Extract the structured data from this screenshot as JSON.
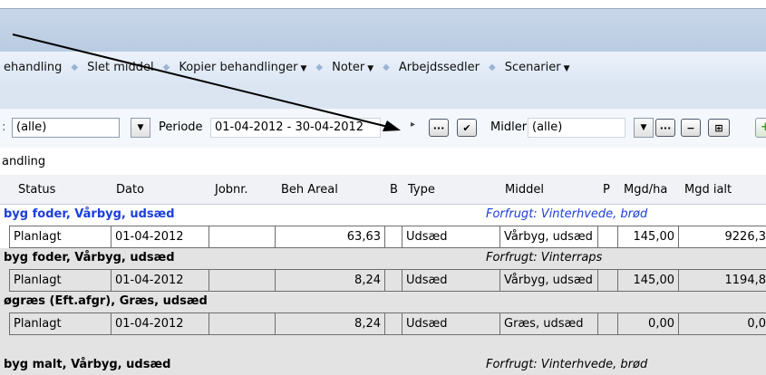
{
  "menu": {
    "items": [
      {
        "label": "ehandling",
        "dropdown": false
      },
      {
        "label": "Slet middel",
        "dropdown": false
      },
      {
        "label": "Kopier behandlinger",
        "dropdown": true
      },
      {
        "label": "Noter",
        "dropdown": true
      },
      {
        "label": "Arbejdssedler",
        "dropdown": false
      },
      {
        "label": "Scenarier",
        "dropdown": true
      }
    ],
    "separator_glyph": "◆",
    "caret_glyph": "▼"
  },
  "filters": {
    "status_prefix": ":",
    "status_value": "(alle)",
    "periode_label": "Periode",
    "periode_value": "01-04-2012 - 30-04-2012",
    "midler_label": "Midler",
    "midler_value": "(alle)",
    "ellipsis_label": "···",
    "check_label": "✔",
    "minus_label": "−",
    "addrow_label": "⊞",
    "next_glyph": "▸"
  },
  "section_title": "andling",
  "columns": [
    "Status",
    "Dato",
    "Jobnr.",
    "Beh Areal",
    "B",
    "Type",
    "Middel",
    "P",
    "Mgd/ha",
    "Mgd ialt"
  ],
  "groups": [
    {
      "title": "byg foder, Vårbyg, udsæd",
      "forfrugt": "Forfrugt: Vinterhvede, brød",
      "style": "blue",
      "row": {
        "status": "Planlagt",
        "dato": "01-04-2012",
        "jobnr": "",
        "areal": "63,63",
        "b": "",
        "type": "Udsæd",
        "middel": "Vårbyg, udsæd",
        "p": "",
        "mgd_ha": "145,00",
        "mgd_ialt": "9226,3"
      }
    },
    {
      "title": "byg foder, Vårbyg, udsæd",
      "forfrugt": "Forfrugt: Vinterraps",
      "style": "grey",
      "row": {
        "status": "Planlagt",
        "dato": "01-04-2012",
        "jobnr": "",
        "areal": "8,24",
        "b": "",
        "type": "Udsæd",
        "middel": "Vårbyg, udsæd",
        "p": "",
        "mgd_ha": "145,00",
        "mgd_ialt": "1194,8"
      }
    },
    {
      "title": "øgræs (Eft.afgr), Græs, udsæd",
      "forfrugt": "",
      "style": "grey",
      "row": {
        "status": "Planlagt",
        "dato": "01-04-2012",
        "jobnr": "",
        "areal": "8,24",
        "b": "",
        "type": "Udsæd",
        "middel": "Græs, udsæd",
        "p": "",
        "mgd_ha": "0,00",
        "mgd_ialt": "0,0"
      }
    },
    {
      "title": "byg malt, Vårbyg, udsæd",
      "forfrugt": "Forfrugt: Vinterhvede, brød",
      "style": "grey",
      "row": null
    }
  ],
  "colors": {
    "group_blue": "#1b3edb",
    "titlebar": "#c9d7e9",
    "group_grey": "#e3e3e3"
  }
}
